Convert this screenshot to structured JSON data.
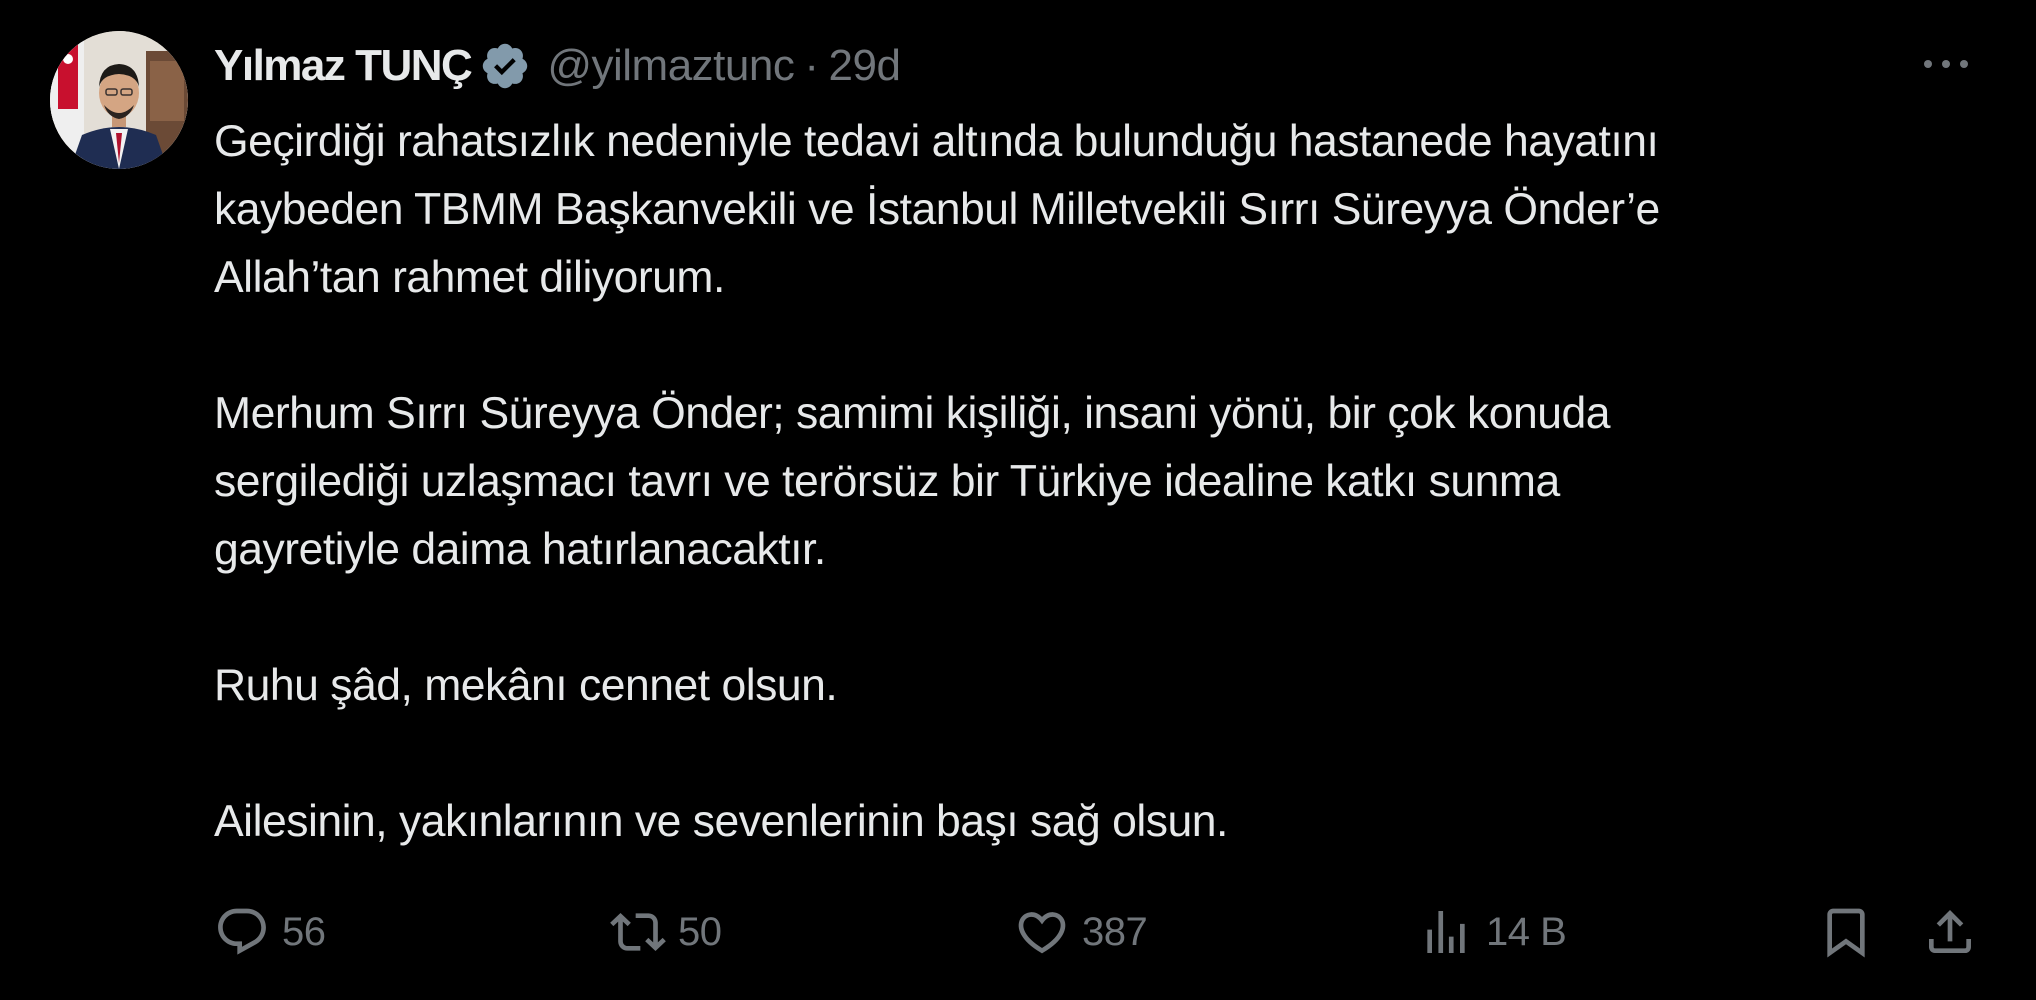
{
  "author": {
    "display_name": "Yılmaz TUNÇ",
    "handle": "@yilmaztunc",
    "separator": "·",
    "time": "29d",
    "verified_icon": "verified-badge-icon",
    "avatar": "avatar"
  },
  "tweet": {
    "paragraphs": [
      "Geçirdiği rahatsızlık nedeniyle tedavi altında bulunduğu hastanede hayatını\nkaybeden TBMM Başkanvekili ve İstanbul Milletvekili Sırrı Süreyya Önder’e\nAllah’tan rahmet diliyorum.",
      "Merhum Sırrı Süreyya Önder; samimi kişiliği, insani yönü, bir çok konuda\nsergilediği uzlaşmacı tavrı ve terörsüz bir Türkiye idealine katkı sunma\ngayretiyle daima hatırlanacaktır.",
      "Ruhu şâd, mekânı cennet olsun.",
      "Ailesinin, yakınlarının ve sevenlerinin başı sağ olsun."
    ]
  },
  "actions": {
    "reply": {
      "icon": "reply-icon",
      "count": "56"
    },
    "repost": {
      "icon": "repost-icon",
      "count": "50"
    },
    "like": {
      "icon": "heart-icon",
      "count": "387"
    },
    "views": {
      "icon": "views-icon",
      "count": "14 B"
    },
    "bookmark": {
      "icon": "bookmark-icon"
    },
    "share": {
      "icon": "share-icon"
    },
    "more": {
      "icon": "more-icon"
    }
  },
  "colors": {
    "background": "#000000",
    "text_primary": "#e7e9ea",
    "text_secondary": "#71767b",
    "verified_badge": "#829aab"
  }
}
